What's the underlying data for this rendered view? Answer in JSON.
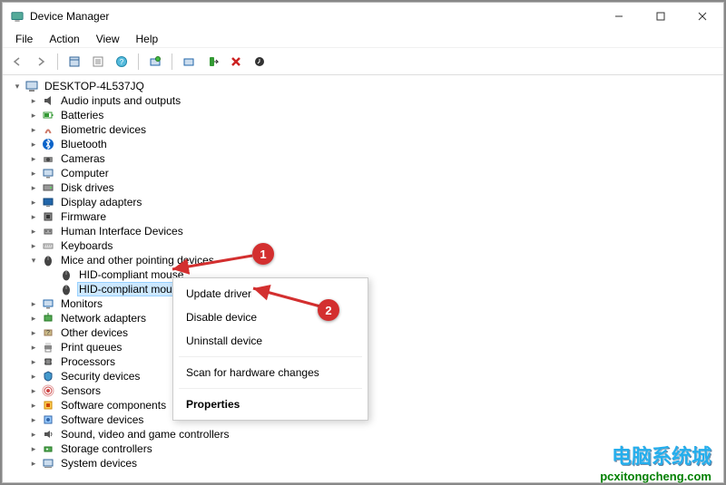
{
  "window": {
    "title": "Device Manager"
  },
  "menus": {
    "file": "File",
    "action": "Action",
    "view": "View",
    "help": "Help"
  },
  "root": {
    "name": "DESKTOP-4L537JQ"
  },
  "categories": [
    {
      "label": "Audio inputs and outputs",
      "icon": "audio"
    },
    {
      "label": "Batteries",
      "icon": "battery"
    },
    {
      "label": "Biometric devices",
      "icon": "biometric"
    },
    {
      "label": "Bluetooth",
      "icon": "bluetooth"
    },
    {
      "label": "Cameras",
      "icon": "camera"
    },
    {
      "label": "Computer",
      "icon": "computer"
    },
    {
      "label": "Disk drives",
      "icon": "disk"
    },
    {
      "label": "Display adapters",
      "icon": "display"
    },
    {
      "label": "Firmware",
      "icon": "firmware"
    },
    {
      "label": "Human Interface Devices",
      "icon": "hid"
    },
    {
      "label": "Keyboards",
      "icon": "keyboard"
    }
  ],
  "expanded_category": {
    "label": "Mice and other pointing devices",
    "icon": "mouse",
    "children": [
      {
        "label": "HID-compliant mouse",
        "selected": false
      },
      {
        "label": "HID-compliant mouse",
        "selected": true
      }
    ]
  },
  "categories_after": [
    {
      "label": "Monitors",
      "icon": "monitor"
    },
    {
      "label": "Network adapters",
      "icon": "network"
    },
    {
      "label": "Other devices",
      "icon": "other"
    },
    {
      "label": "Print queues",
      "icon": "printer"
    },
    {
      "label": "Processors",
      "icon": "cpu"
    },
    {
      "label": "Security devices",
      "icon": "security"
    },
    {
      "label": "Sensors",
      "icon": "sensor"
    },
    {
      "label": "Software components",
      "icon": "swcomp"
    },
    {
      "label": "Software devices",
      "icon": "swdev"
    },
    {
      "label": "Sound, video and game controllers",
      "icon": "sound"
    },
    {
      "label": "Storage controllers",
      "icon": "storage"
    },
    {
      "label": "System devices",
      "icon": "system"
    }
  ],
  "context_menu": {
    "update": "Update driver",
    "disable": "Disable device",
    "uninstall": "Uninstall device",
    "scan": "Scan for hardware changes",
    "properties": "Properties"
  },
  "annotations": {
    "badge1": "1",
    "badge2": "2"
  },
  "watermark": {
    "cn": "电脑系统城",
    "url": "pcxitongcheng.com"
  }
}
